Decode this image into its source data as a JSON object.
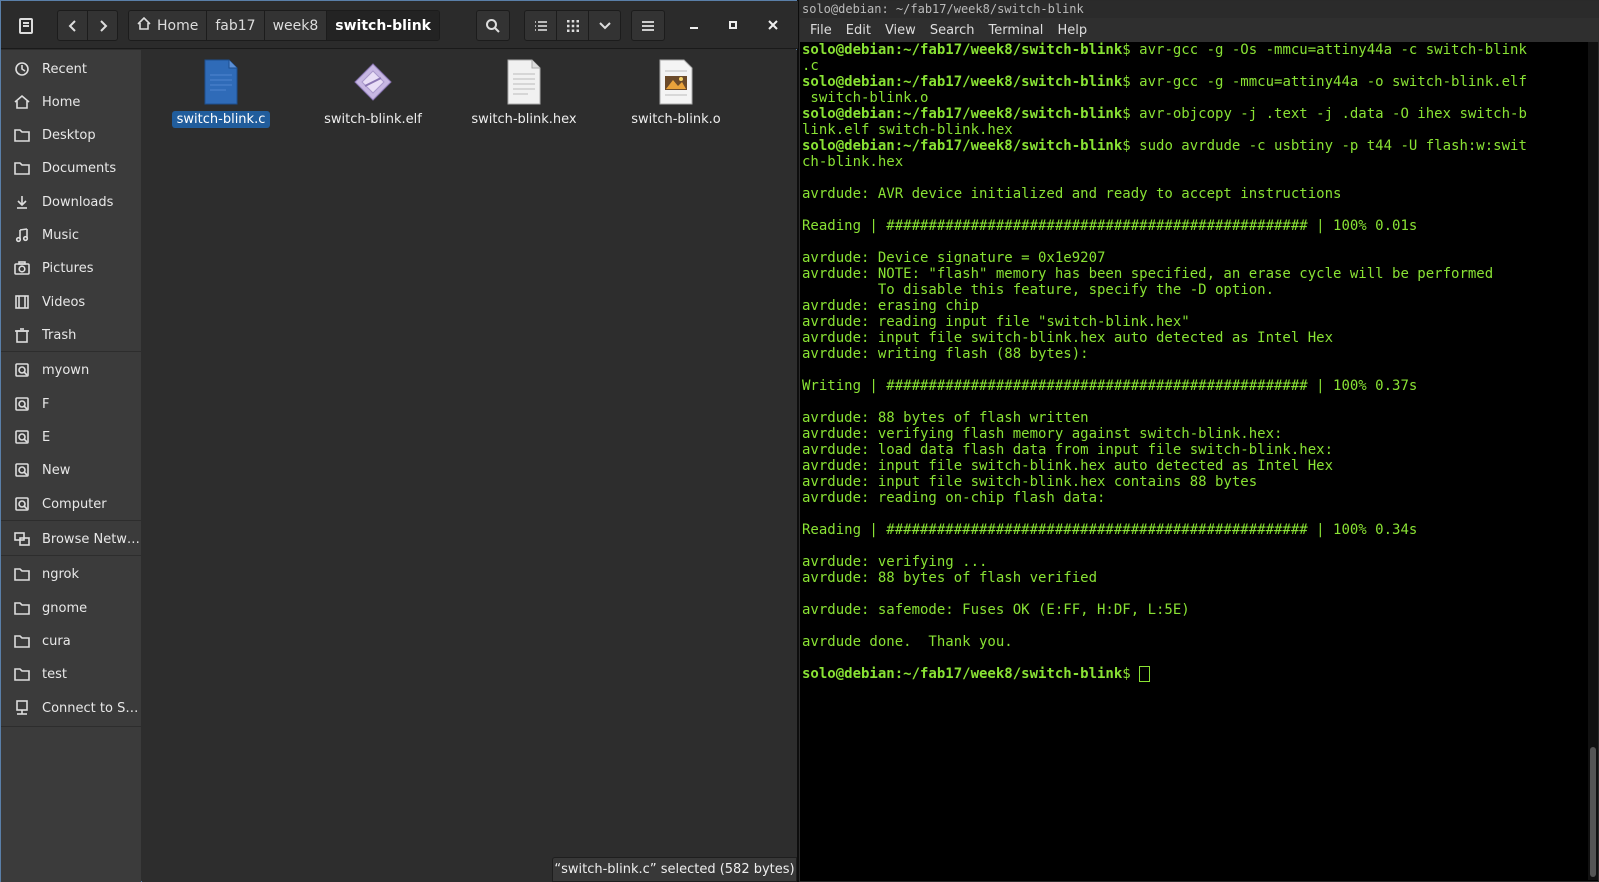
{
  "file_manager": {
    "breadcrumbs": [
      "Home",
      "fab17",
      "week8",
      "switch-blink"
    ],
    "sidebar": [
      {
        "label": "Recent",
        "icon": "clock-icon"
      },
      {
        "label": "Home",
        "icon": "home-icon"
      },
      {
        "label": "Desktop",
        "icon": "folder-icon"
      },
      {
        "label": "Documents",
        "icon": "folder-icon"
      },
      {
        "label": "Downloads",
        "icon": "download-icon"
      },
      {
        "label": "Music",
        "icon": "music-icon"
      },
      {
        "label": "Pictures",
        "icon": "camera-icon"
      },
      {
        "label": "Videos",
        "icon": "film-icon"
      },
      {
        "label": "Trash",
        "icon": "trash-icon"
      },
      {
        "label": "myown",
        "icon": "drive-icon"
      },
      {
        "label": "F",
        "icon": "drive-icon"
      },
      {
        "label": "E",
        "icon": "drive-icon"
      },
      {
        "label": "New",
        "icon": "drive-icon"
      },
      {
        "label": "Computer",
        "icon": "drive-icon"
      },
      {
        "label": "Browse Network",
        "icon": "network-icon"
      },
      {
        "label": "ngrok",
        "icon": "folder-icon"
      },
      {
        "label": "gnome",
        "icon": "folder-icon"
      },
      {
        "label": "cura",
        "icon": "folder-icon"
      },
      {
        "label": "test",
        "icon": "folder-icon"
      },
      {
        "label": "Connect to S…",
        "icon": "server-icon"
      }
    ],
    "files": [
      {
        "name": "switch-blink.c",
        "icon": "c-source-file-icon",
        "selected": true
      },
      {
        "name": "switch-blink.elf",
        "icon": "executable-file-icon",
        "selected": false
      },
      {
        "name": "switch-blink.hex",
        "icon": "text-file-icon",
        "selected": false
      },
      {
        "name": "switch-blink.o",
        "icon": "object-file-icon",
        "selected": false
      }
    ],
    "status": "“switch-blink.c” selected  (582 bytes)"
  },
  "terminal": {
    "title": "solo@debian: ~/fab17/week8/switch-blink",
    "menu": [
      "File",
      "Edit",
      "View",
      "Search",
      "Terminal",
      "Help"
    ],
    "prompt_user": "solo@debian",
    "prompt_path": ":~/fab17/week8/switch-blink",
    "lines": [
      {
        "p": true,
        "t": "$ avr-gcc -g -Os -mmcu=attiny44a -c switch-blink"
      },
      {
        "p": false,
        "t": ".c"
      },
      {
        "p": true,
        "t": "$ avr-gcc -g -mmcu=attiny44a -o switch-blink.elf"
      },
      {
        "p": false,
        "t": " switch-blink.o"
      },
      {
        "p": true,
        "t": "$ avr-objcopy -j .text -j .data -O ihex switch-b"
      },
      {
        "p": false,
        "t": "link.elf switch-blink.hex"
      },
      {
        "p": true,
        "t": "$ sudo avrdude -c usbtiny -p t44 -U flash:w:swit"
      },
      {
        "p": false,
        "t": "ch-blink.hex"
      },
      {
        "p": false,
        "t": ""
      },
      {
        "p": false,
        "t": "avrdude: AVR device initialized and ready to accept instructions"
      },
      {
        "p": false,
        "t": ""
      },
      {
        "p": false,
        "t": "Reading | ################################################## | 100% 0.01s"
      },
      {
        "p": false,
        "t": ""
      },
      {
        "p": false,
        "t": "avrdude: Device signature = 0x1e9207"
      },
      {
        "p": false,
        "t": "avrdude: NOTE: \"flash\" memory has been specified, an erase cycle will be performed"
      },
      {
        "p": false,
        "t": "         To disable this feature, specify the -D option."
      },
      {
        "p": false,
        "t": "avrdude: erasing chip"
      },
      {
        "p": false,
        "t": "avrdude: reading input file \"switch-blink.hex\""
      },
      {
        "p": false,
        "t": "avrdude: input file switch-blink.hex auto detected as Intel Hex"
      },
      {
        "p": false,
        "t": "avrdude: writing flash (88 bytes):"
      },
      {
        "p": false,
        "t": ""
      },
      {
        "p": false,
        "t": "Writing | ################################################## | 100% 0.37s"
      },
      {
        "p": false,
        "t": ""
      },
      {
        "p": false,
        "t": "avrdude: 88 bytes of flash written"
      },
      {
        "p": false,
        "t": "avrdude: verifying flash memory against switch-blink.hex:"
      },
      {
        "p": false,
        "t": "avrdude: load data flash data from input file switch-blink.hex:"
      },
      {
        "p": false,
        "t": "avrdude: input file switch-blink.hex auto detected as Intel Hex"
      },
      {
        "p": false,
        "t": "avrdude: input file switch-blink.hex contains 88 bytes"
      },
      {
        "p": false,
        "t": "avrdude: reading on-chip flash data:"
      },
      {
        "p": false,
        "t": ""
      },
      {
        "p": false,
        "t": "Reading | ################################################## | 100% 0.34s"
      },
      {
        "p": false,
        "t": ""
      },
      {
        "p": false,
        "t": "avrdude: verifying ..."
      },
      {
        "p": false,
        "t": "avrdude: 88 bytes of flash verified"
      },
      {
        "p": false,
        "t": ""
      },
      {
        "p": false,
        "t": "avrdude: safemode: Fuses OK (E:FF, H:DF, L:5E)"
      },
      {
        "p": false,
        "t": ""
      },
      {
        "p": false,
        "t": "avrdude done.  Thank you."
      },
      {
        "p": false,
        "t": ""
      },
      {
        "p": true,
        "t": "$ ",
        "cursor": true
      }
    ]
  }
}
